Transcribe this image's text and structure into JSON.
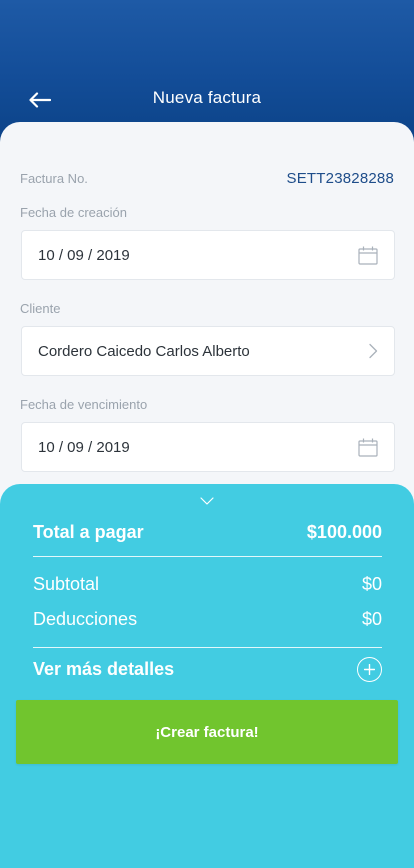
{
  "header": {
    "title": "Nueva factura",
    "back_icon": "arrow-left-icon"
  },
  "form": {
    "invoice_no_label": "Factura No.",
    "invoice_no_value": "SETT23828288",
    "creation_date_label": "Fecha de creación",
    "creation_date_value": "10 / 09 / 2019",
    "client_label": "Cliente",
    "client_value": "Cordero Caicedo Carlos Alberto",
    "due_date_label": "Fecha de vencimiento",
    "due_date_value": "10 / 09 / 2019",
    "calendar_icon": "calendar-icon",
    "chevron_icon": "chevron-right-icon"
  },
  "summary": {
    "total_label": "Total a pagar",
    "total_value": "$100.000",
    "subtotal_label": "Subtotal",
    "subtotal_value": "$0",
    "deductions_label": "Deducciones",
    "deductions_value": "$0",
    "details_label": "Ver más detalles",
    "create_button_label": "¡Crear factura!"
  },
  "colors": {
    "header_blue": "#134d98",
    "summary_cyan": "#42cce2",
    "button_green": "#71c52e",
    "invoice_number_blue": "#1e4d8a"
  }
}
